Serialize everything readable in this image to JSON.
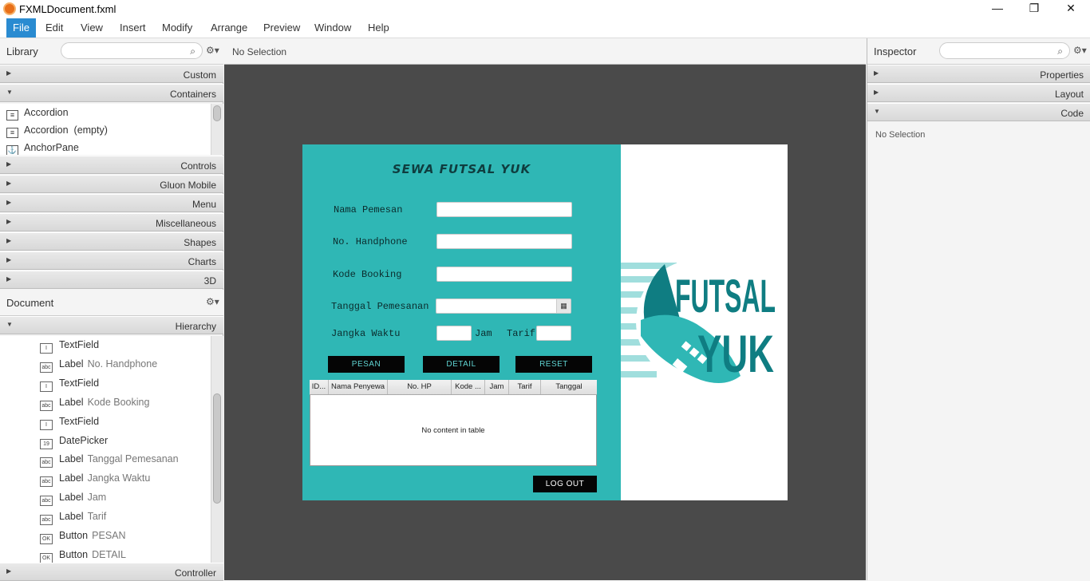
{
  "window": {
    "title": "FXMLDocument.fxml",
    "minimize": "—",
    "maximize": "❐",
    "close": "✕"
  },
  "menu": [
    "File",
    "Edit",
    "View",
    "Insert",
    "Modify",
    "Arrange",
    "Preview",
    "Window",
    "Help"
  ],
  "library": {
    "title": "Library",
    "sections_top": [
      "Custom",
      "Containers"
    ],
    "items": [
      "Accordion",
      "Accordion  (empty)",
      "AnchorPane"
    ],
    "sections_bottom": [
      "Controls",
      "Gluon Mobile",
      "Menu",
      "Miscellaneous",
      "Shapes",
      "Charts",
      "3D"
    ]
  },
  "document": {
    "title": "Document",
    "hierarchy_label": "Hierarchy",
    "controller_label": "Controller",
    "items": [
      {
        "icon": "I",
        "type": "TextField",
        "name": ""
      },
      {
        "icon": "abc",
        "type": "Label",
        "name": "No. Handphone"
      },
      {
        "icon": "I",
        "type": "TextField",
        "name": ""
      },
      {
        "icon": "abc",
        "type": "Label",
        "name": "Kode Booking"
      },
      {
        "icon": "I",
        "type": "TextField",
        "name": ""
      },
      {
        "icon": "19",
        "type": "DatePicker",
        "name": ""
      },
      {
        "icon": "abc",
        "type": "Label",
        "name": "Tanggal Pemesanan"
      },
      {
        "icon": "abc",
        "type": "Label",
        "name": "Jangka Waktu"
      },
      {
        "icon": "abc",
        "type": "Label",
        "name": "Jam"
      },
      {
        "icon": "abc",
        "type": "Label",
        "name": "Tarif"
      },
      {
        "icon": "OK",
        "type": "Button",
        "name": "PESAN"
      },
      {
        "icon": "OK",
        "type": "Button",
        "name": "DETAIL"
      }
    ]
  },
  "center": {
    "selection": "No Selection"
  },
  "form": {
    "title": "SEWA FUTSAL YUK",
    "labels": {
      "nama": "Nama Pemesan",
      "hp": "No. Handphone",
      "kode": "Kode Booking",
      "tanggal": "Tanggal Pemesanan",
      "jangka": "Jangka Waktu",
      "jam": "Jam",
      "tarif": "Tarif"
    },
    "buttons": {
      "pesan": "PESAN",
      "detail": "DETAIL",
      "reset": "RESET",
      "logout": "LOG OUT"
    },
    "table": {
      "columns": [
        "ID...",
        "Nama Penyewa",
        "No. HP",
        "Kode ...",
        "Jam",
        "Tarif",
        "Tanggal"
      ],
      "empty": "No content in table"
    },
    "logo": {
      "line1": "FUTSAL",
      "line2": "YUK"
    }
  },
  "inspector": {
    "title": "Inspector",
    "sections": [
      "Properties",
      "Layout",
      "Code"
    ],
    "selection": "No Selection"
  },
  "colors": {
    "accent": "#2a8bd1",
    "form_bg": "#2fb7b5",
    "logo": "#0f7d82"
  }
}
